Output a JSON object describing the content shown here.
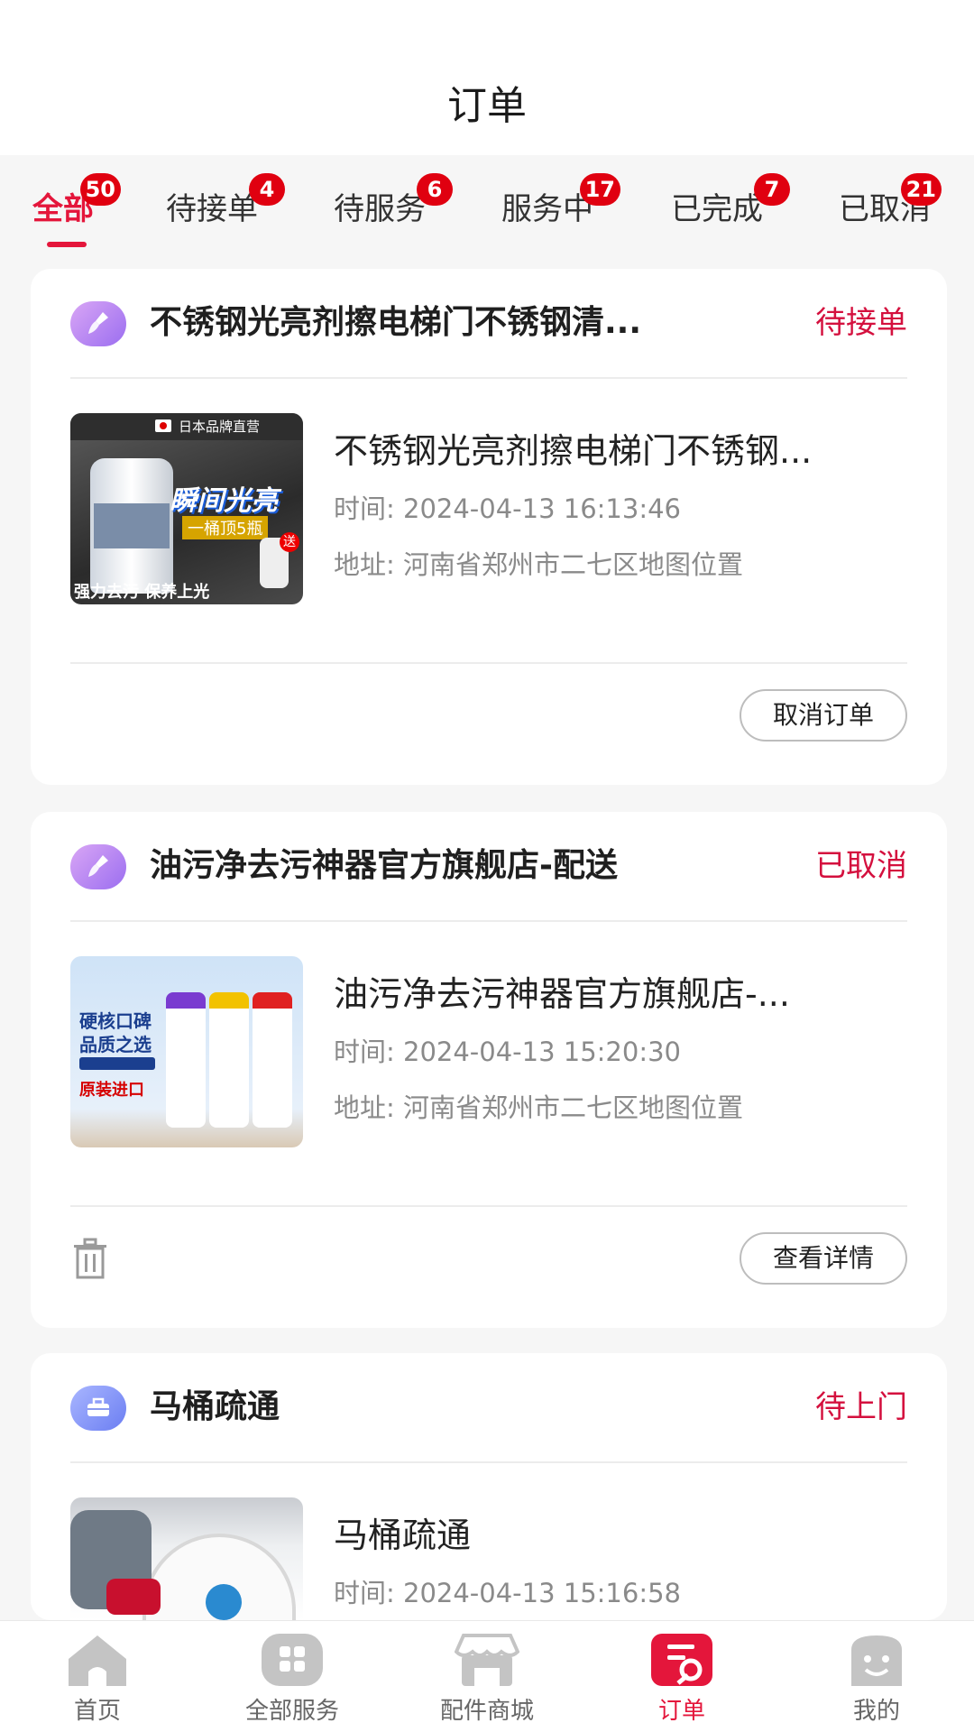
{
  "header": {
    "title": "订单"
  },
  "tabs": [
    {
      "label": "全部",
      "badge": "50",
      "active": true
    },
    {
      "label": "待接单",
      "badge": "4"
    },
    {
      "label": "待服务",
      "badge": "6"
    },
    {
      "label": "服务中",
      "badge": "17"
    },
    {
      "label": "已完成",
      "badge": "7"
    },
    {
      "label": "已取消",
      "badge": "21"
    }
  ],
  "orders": [
    {
      "shop_name": "不锈钢光亮剂擦电梯门不锈钢清...",
      "status": "待接单",
      "product_title": "不锈钢光亮剂擦电梯门不锈钢...",
      "time_label": "时间:",
      "time": "2024-04-13 16:13:46",
      "address_label": "地址:",
      "address": "河南省郑州市二七区地图位置",
      "image_text": {
        "brand": "日本品牌直营",
        "headline": "瞬间光亮",
        "sub": "一桶顶5瓶",
        "gift": "送",
        "slogan": "强力去污 保养上光"
      },
      "action": "取消订单"
    },
    {
      "shop_name": "油污净去污神器官方旗舰店-配送",
      "status": "已取消",
      "product_title": "油污净去污神器官方旗舰店-...",
      "time_label": "时间:",
      "time": "2024-04-13 15:20:30",
      "address_label": "地址:",
      "address": "河南省郑州市二七区地图位置",
      "image_text": {
        "line1": "硬核口碑",
        "line2": "品质之选",
        "line3": "原装进口"
      },
      "action": "查看详情"
    },
    {
      "shop_name": "马桶疏通",
      "status": "待上门",
      "product_title": "马桶疏通",
      "time_label": "时间:",
      "time": "2024-04-13 15:16:58"
    }
  ],
  "bottom_nav": [
    {
      "label": "首页",
      "icon": "home-icon"
    },
    {
      "label": "全部服务",
      "icon": "grid-icon"
    },
    {
      "label": "配件商城",
      "icon": "store-icon"
    },
    {
      "label": "订单",
      "icon": "order-icon",
      "active": true
    },
    {
      "label": "我的",
      "icon": "profile-icon"
    }
  ],
  "colors": {
    "accent": "#e4163b",
    "badge": "#e00010",
    "muted": "#8a8a8a"
  }
}
